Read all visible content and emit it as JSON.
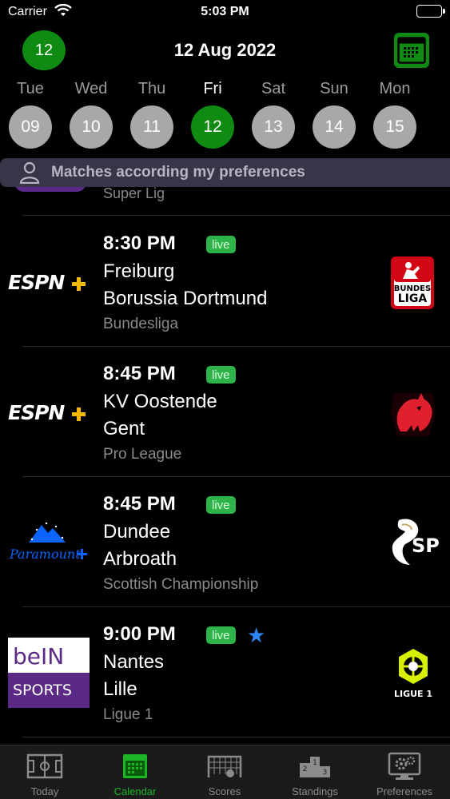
{
  "status_bar": {
    "carrier": "Carrier",
    "time": "5:03 PM"
  },
  "header": {
    "today_number": "12",
    "date": "12 Aug 2022"
  },
  "days": [
    {
      "name": "Tue",
      "number": "09",
      "active": false
    },
    {
      "name": "Wed",
      "number": "10",
      "active": false
    },
    {
      "name": "Thu",
      "number": "11",
      "active": false
    },
    {
      "name": "Fri",
      "number": "12",
      "active": true
    },
    {
      "name": "Sat",
      "number": "13",
      "active": false
    },
    {
      "name": "Sun",
      "number": "14",
      "active": false
    },
    {
      "name": "Mon",
      "number": "15",
      "active": false
    }
  ],
  "preferences_banner": {
    "text": "Matches according my preferences"
  },
  "partial_match": {
    "league": "Super Lig"
  },
  "matches": [
    {
      "time": "8:30 PM",
      "live": "live",
      "starred": false,
      "home": "Freiburg",
      "away": "Borussia Dortmund",
      "league": "Bundesliga",
      "broadcaster": "espn-plus-logo",
      "league_logo": "bundesliga-logo",
      "league_logo_text": [
        "BUNDES",
        "LIGA"
      ]
    },
    {
      "time": "8:45 PM",
      "live": "live",
      "starred": false,
      "home": "KV Oostende",
      "away": "Gent",
      "league": "Pro League",
      "broadcaster": "espn-plus-logo",
      "league_logo": "pro-league-logo"
    },
    {
      "time": "8:45 PM",
      "live": "live",
      "starred": false,
      "home": "Dundee",
      "away": "Arbroath",
      "league": "Scottish Championship",
      "broadcaster": "paramount-plus-logo",
      "broadcaster_text": "Paramount",
      "league_logo": "spfl-logo",
      "league_logo_text": [
        "SP"
      ]
    },
    {
      "time": "9:00 PM",
      "live": "live",
      "starred": true,
      "home": "Nantes",
      "away": "Lille",
      "league": "Ligue 1",
      "broadcaster": "bein-sports-logo",
      "broadcaster_text": [
        "beIN",
        "SPORTS"
      ],
      "league_logo": "ligue1-logo",
      "league_logo_text": [
        "LIGUE 1"
      ]
    }
  ],
  "tabs": [
    {
      "label": "Today",
      "icon": "pitch-icon",
      "active": false
    },
    {
      "label": "Calendar",
      "icon": "calendar-icon",
      "active": true
    },
    {
      "label": "Scores",
      "icon": "goal-net-icon",
      "active": false
    },
    {
      "label": "Standings",
      "icon": "podium-icon",
      "active": false
    },
    {
      "label": "Preferences",
      "icon": "settings-monitor-icon",
      "active": false
    }
  ],
  "colors": {
    "accent_green": "#0f8a13",
    "live_green": "#2db34a",
    "star_blue": "#2f84f5",
    "banner_bg": "#3a3448"
  }
}
